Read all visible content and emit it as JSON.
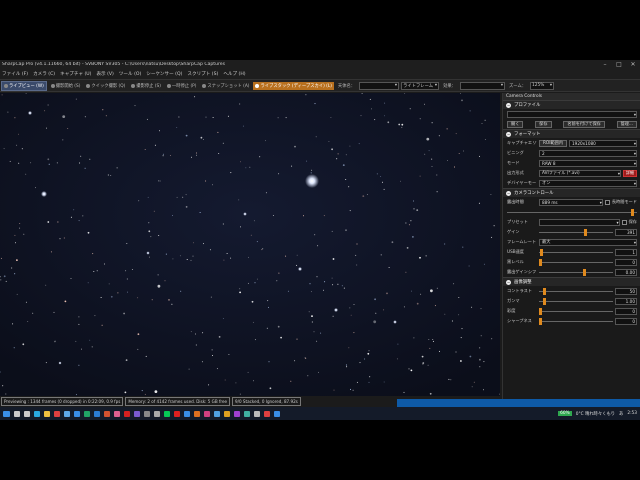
{
  "window": {
    "title": "SharpCap Pro (v4.1.11660, 64 bit) - SVBONY SV305 - C:\\Users\\natsu\\Desktop\\SharpCap Captures",
    "controls": [
      "–",
      "□",
      "✕"
    ]
  },
  "menu": [
    "ファイル (F)",
    "カメラ (C)",
    "キャプチャ (U)",
    "表示 (V)",
    "ツール (O)",
    "シーケンサー (Q)",
    "スクリプト (S)",
    "ヘルプ (H)"
  ],
  "toolbar": {
    "items": [
      {
        "label": "ライブビュー (W)",
        "icon": "camera-icon",
        "state": "active"
      },
      {
        "label": "撮影開始 (S)",
        "icon": "record-icon"
      },
      {
        "label": "クイック撮影 (Q)",
        "icon": "quick-capture-icon"
      },
      {
        "label": "撮影停止 (S)",
        "icon": "stop-icon"
      },
      {
        "label": "一時停止 (P)",
        "icon": "pause-icon"
      },
      {
        "label": "スナップショット (A)",
        "icon": "snapshot-icon"
      },
      {
        "label": "ライブスタック (ディープスカイ) (L)",
        "icon": "live-stack-icon",
        "state": "live"
      }
    ],
    "target_label": "天体名：",
    "target_value": "",
    "frame_type": "ライトフレーム",
    "effect_label": "効果：",
    "effect_value": "",
    "zoom_label": "ズーム：",
    "zoom_value": "125%"
  },
  "status": {
    "preview": "Previewing : 1344 frames (0 dropped) in 0:22:09, 0.9 fps",
    "memory": "Memory: 2 of 4142 frames used. Disk: 5 GB free",
    "stack": "9/0 Stacked, 0 Ignored, 87.92s"
  },
  "panel": {
    "title": "Camera Controls",
    "sections": {
      "profile": {
        "title": "プロファイル",
        "buttons": [
          "開く",
          "保存",
          "名前を付けて保存",
          "管理..."
        ]
      },
      "format": {
        "title": "フォーマット",
        "rows": [
          {
            "label": "キャプチャエリア",
            "value": "1920x1080",
            "button": "ROI範囲内"
          },
          {
            "label": "ビニング",
            "value": "2"
          },
          {
            "label": "モード",
            "value": "RAW 8"
          },
          {
            "label": "出力形式",
            "value": "AVIファイル (*.avi)",
            "warning": "詳細"
          },
          {
            "label": "デバイヤーモード",
            "value": "オン"
          }
        ]
      },
      "camera": {
        "title": "カメラコントロール",
        "exposure_label": "露出時間",
        "exposure_value": "889 ms",
        "long_exposure": "長時間モード",
        "preset_label": "プリセット",
        "preset_value": "",
        "save_label": "保存",
        "gain_label": "ゲイン",
        "gain_value": "391",
        "gain_level": 0.64,
        "frame_rate_label": "フレームレート",
        "frame_rate_value": "最大",
        "usb_label": "USB速度",
        "usb_value": "1",
        "usb_level": 0.02,
        "black_label": "黒レベル",
        "black_value": "0",
        "black_level": 0.0,
        "autogain_label": "露出ゲインシフト",
        "autogain_value": "0.00",
        "autogain_level": 0.62
      },
      "image": {
        "title": "画像調整",
        "rows": [
          {
            "label": "コントラスト",
            "value": "50",
            "level": 0.05
          },
          {
            "label": "ガンマ",
            "value": "1.00",
            "level": 0.06
          },
          {
            "label": "彩度",
            "value": "0",
            "level": 0.0
          },
          {
            "label": "シャープネス",
            "value": "0",
            "level": 0.0
          }
        ]
      }
    }
  },
  "tray": {
    "battery": "60%",
    "weather": "0°C  晴れ時々くもり",
    "ime": "あ",
    "time": "2:53"
  },
  "taskbar_icons": [
    {
      "name": "windows-icon",
      "color": "#3a8ee6"
    },
    {
      "name": "search-icon",
      "color": "#cccccc"
    },
    {
      "name": "task-view-icon",
      "color": "#cccccc"
    },
    {
      "name": "edge-icon",
      "color": "#2aa9e0"
    },
    {
      "name": "folder-icon",
      "color": "#f0c040"
    },
    {
      "name": "chrome-icon",
      "color": "#e04040"
    },
    {
      "name": "store-icon",
      "color": "#5fa8e8"
    },
    {
      "name": "mail-icon",
      "color": "#3a8ee6"
    },
    {
      "name": "excel-icon",
      "color": "#21a366"
    },
    {
      "name": "word-icon",
      "color": "#2b7cd3"
    },
    {
      "name": "powerpoint-icon",
      "color": "#d35230"
    },
    {
      "name": "photos-icon",
      "color": "#e06090"
    },
    {
      "name": "acrobat-icon",
      "color": "#d42020"
    },
    {
      "name": "app-icon",
      "color": "#7a5ad0"
    },
    {
      "name": "camera-app-icon",
      "color": "#888888"
    },
    {
      "name": "settings-icon",
      "color": "#aaaaaa"
    },
    {
      "name": "line-icon",
      "color": "#06c755"
    },
    {
      "name": "youtube-icon",
      "color": "#e02020"
    },
    {
      "name": "app-icon",
      "color": "#3a8ee6"
    },
    {
      "name": "app-icon",
      "color": "#e07020"
    },
    {
      "name": "app-icon",
      "color": "#d04080"
    },
    {
      "name": "app-icon",
      "color": "#50a0e0"
    },
    {
      "name": "app-icon",
      "color": "#e0a020"
    },
    {
      "name": "app-icon",
      "color": "#a040d0"
    },
    {
      "name": "app-icon",
      "color": "#40b0a0"
    },
    {
      "name": "sharpcap-icon",
      "color": "#bbbbbb"
    },
    {
      "name": "app-icon",
      "color": "#e04040"
    },
    {
      "name": "app-icon",
      "color": "#3a8ee6"
    }
  ]
}
